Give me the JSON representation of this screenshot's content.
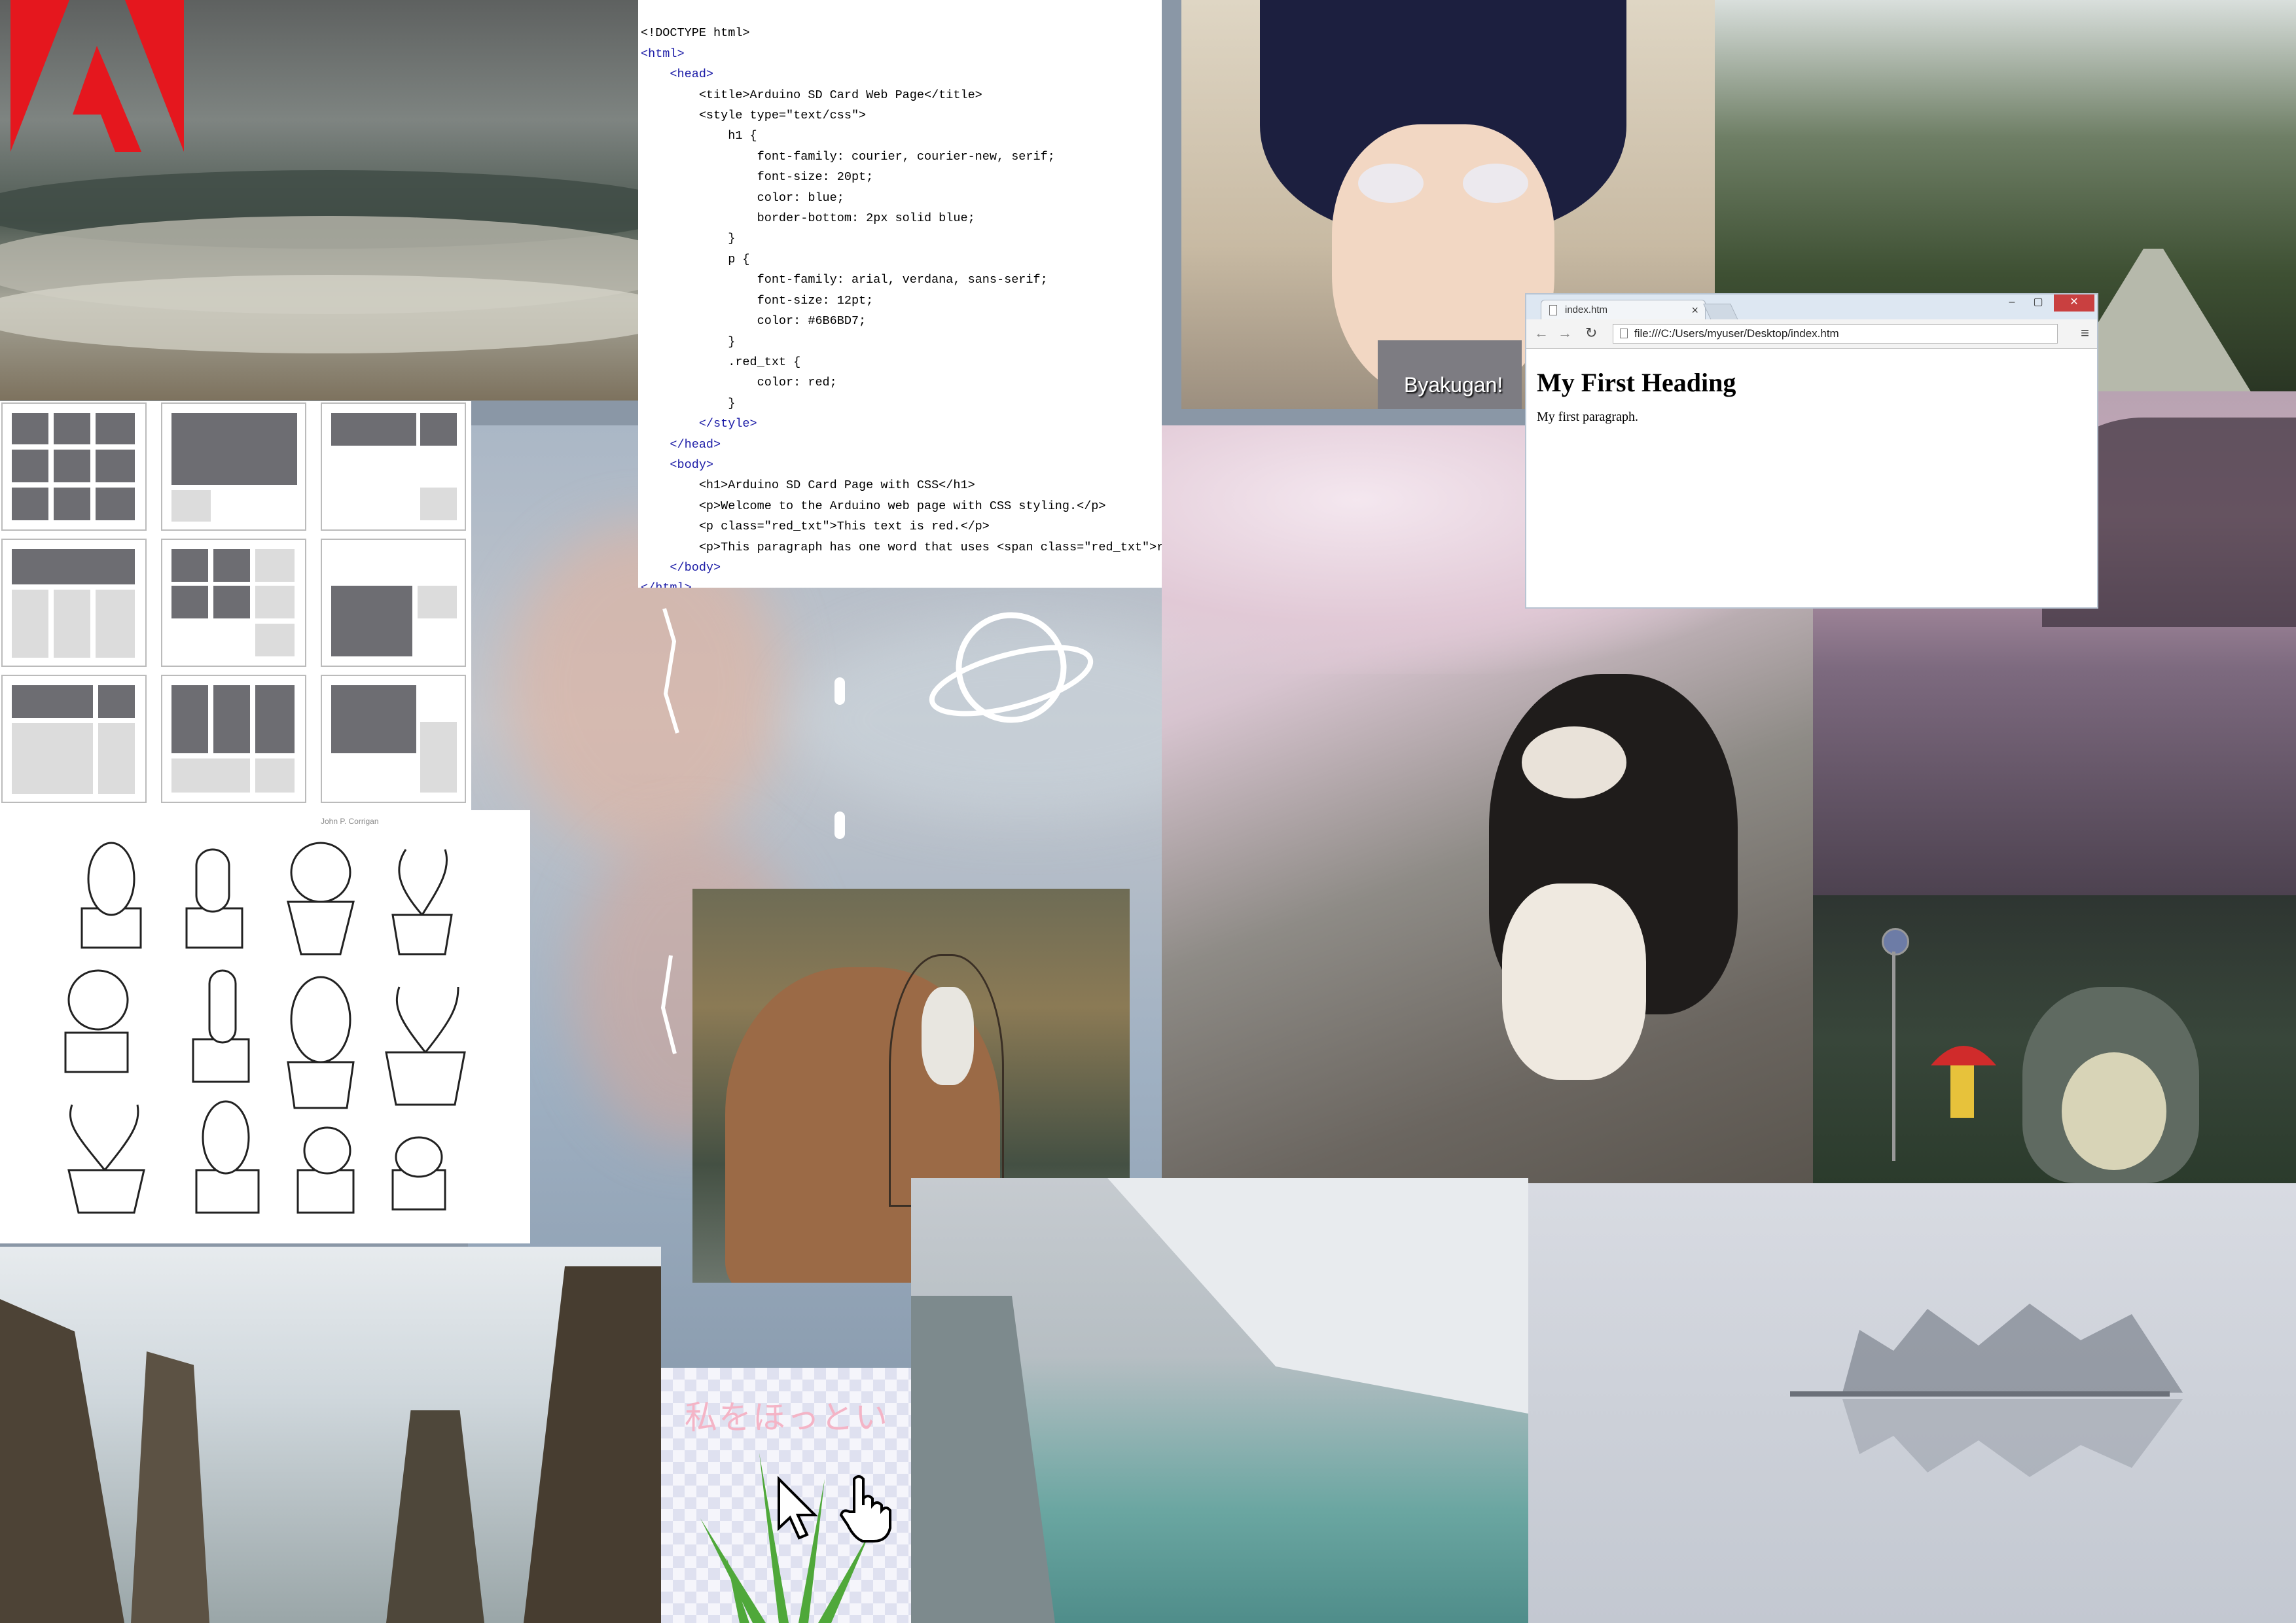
{
  "code_editor": {
    "lines": [
      "<!DOCTYPE html>",
      "<html>",
      "    <head>",
      "        <title>Arduino SD Card Web Page</title>",
      "        <style type=\"text/css\">",
      "            h1 {",
      "                font-family: courier, courier-new, serif;",
      "                font-size: 20pt;",
      "                color: blue;",
      "                border-bottom: 2px solid blue;",
      "            }",
      "            p {",
      "                font-family: arial, verdana, sans-serif;",
      "                font-size: 12pt;",
      "                color: #6B6BD7;",
      "            }",
      "            .red_txt {",
      "                color: red;",
      "            }",
      "        </style>",
      "    </head>",
      "    <body>",
      "        <h1>Arduino SD Card Page with CSS</h1>",
      "        <p>Welcome to the Arduino web page with CSS styling.</p>",
      "        <p class=\"red_txt\">This text is red.</p>",
      "        <p>This paragraph has one word that uses <span class=\"red_txt\">red</span>",
      "    </body>",
      "</html>"
    ]
  },
  "browser": {
    "tab_title": "index.htm",
    "tab_close": "×",
    "address": "file:///C:/Users/myuser/Desktop/index.htm",
    "heading": "My First Heading",
    "paragraph": "My first paragraph.",
    "controls": {
      "minimize": "–",
      "maximize": "▢",
      "close": "✕"
    },
    "nav": {
      "back": "←",
      "forward": "→",
      "reload": "↻",
      "menu": "≡"
    }
  },
  "anime": {
    "subtitle": "Byakugan!"
  },
  "cactus": {
    "caption": "John P. Corrigan"
  },
  "pixel_art": {
    "japanese_text": "私をほっとい"
  },
  "icons": [
    "adobe-logo-icon",
    "hand-cursor-icon",
    "arrow-cursor-icon",
    "planet-doodle-icon",
    "umbrella-icon"
  ]
}
